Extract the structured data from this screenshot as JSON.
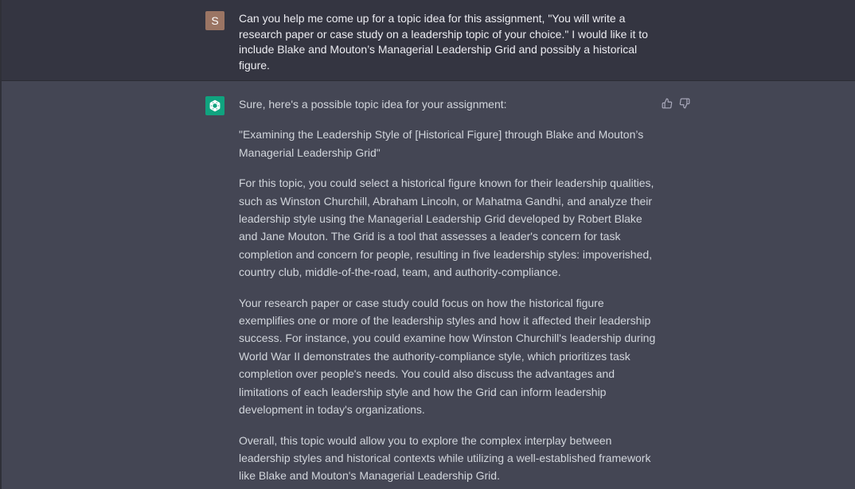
{
  "conversation": {
    "user_message": {
      "avatar_initial": "S",
      "text": "Can you help me come up for a topic idea for this assignment, \"You will write a research paper or case study on a leadership topic of your choice.\" I would like it to include Blake and Mouton’s Managerial Leadership Grid and possibly a historical figure."
    },
    "assistant_message": {
      "avatar_icon": "openai-logo-icon",
      "paragraphs": [
        "Sure, here's a possible topic idea for your assignment:",
        "\"Examining the Leadership Style of [Historical Figure] through Blake and Mouton’s Managerial Leadership Grid\"",
        "For this topic, you could select a historical figure known for their leadership qualities, such as Winston Churchill, Abraham Lincoln, or Mahatma Gandhi, and analyze their leadership style using the Managerial Leadership Grid developed by Robert Blake and Jane Mouton. The Grid is a tool that assesses a leader's concern for task completion and concern for people, resulting in five leadership styles: impoverished, country club, middle-of-the-road, team, and authority-compliance.",
        "Your research paper or case study could focus on how the historical figure exemplifies one or more of the leadership styles and how it affected their leadership success. For instance, you could examine how Winston Churchill's leadership during World War II demonstrates the authority-compliance style, which prioritizes task completion over people's needs. You could also discuss the advantages and limitations of each leadership style and how the Grid can inform leadership development in today's organizations.",
        "Overall, this topic would allow you to explore the complex interplay between leadership styles and historical contexts while utilizing a well-established framework like Blake and Mouton's Managerial Leadership Grid."
      ],
      "feedback": {
        "thumbs_up_icon": "thumbs-up-icon",
        "thumbs_down_icon": "thumbs-down-icon"
      }
    }
  },
  "colors": {
    "user_bg": "#343541",
    "assistant_bg": "#444654",
    "user_avatar": "#9b7564",
    "assistant_avatar": "#10a37f",
    "text_primary": "#ececf1",
    "text_secondary": "#d1d5db",
    "icon": "#acacbe"
  }
}
